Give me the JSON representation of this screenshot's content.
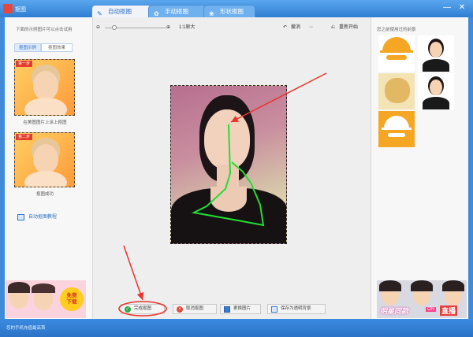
{
  "window": {
    "title": "抠图",
    "minimize_glyph": "—",
    "close_glyph": "✕"
  },
  "tabs": [
    {
      "label": "自动抠图",
      "icon": "brush-icon",
      "active": true
    },
    {
      "label": "手动抠图",
      "icon": "gear-icon",
      "active": false
    },
    {
      "label": "形状抠图",
      "icon": "shape-icon",
      "active": false
    }
  ],
  "left": {
    "hint": "下面的示例图片可以点击试用",
    "subtabs": [
      "抠图示例",
      "抠图效果"
    ],
    "example1": {
      "badge": "第一步",
      "caption": "在美图图片上涂上抠图"
    },
    "example2": {
      "badge": "第二步",
      "caption": "抠图成功"
    },
    "tutorial_label": "自动抠图教程"
  },
  "ad": {
    "badge_line1": "免费",
    "badge_line2": "下载"
  },
  "toolbar": {
    "zoom_out_icon": "zoom-out-icon",
    "zoom_in_icon": "zoom-in-icon",
    "original_size_label": "1:1原大",
    "undo_label": "撤消",
    "redo_glyph": "↪",
    "restart_label": "重新开始",
    "zoom_level": 0.15
  },
  "right": {
    "title": "您之前使用过的前景",
    "banner_text": "明星同款",
    "banner_tag": "直播",
    "banner_badge": "ON"
  },
  "bottom_buttons": [
    {
      "label": "完成抠图",
      "icon": "check-icon",
      "color": "#2ea84a"
    },
    {
      "label": "取消抠图",
      "icon": "cancel-icon",
      "color": "#e0483c"
    },
    {
      "label": "更换图片",
      "icon": "image-icon",
      "color": "#3a7bd5"
    },
    {
      "label": "保存为透明背景",
      "icon": "save-icon",
      "color": "#3a7bd5"
    }
  ],
  "status": {
    "text": "您的手机充值最高首"
  },
  "colors": {
    "accent": "#3a8be0",
    "annotation_red": "#e8342c",
    "stroke_green": "#22dd33",
    "orange": "#f5a623"
  }
}
